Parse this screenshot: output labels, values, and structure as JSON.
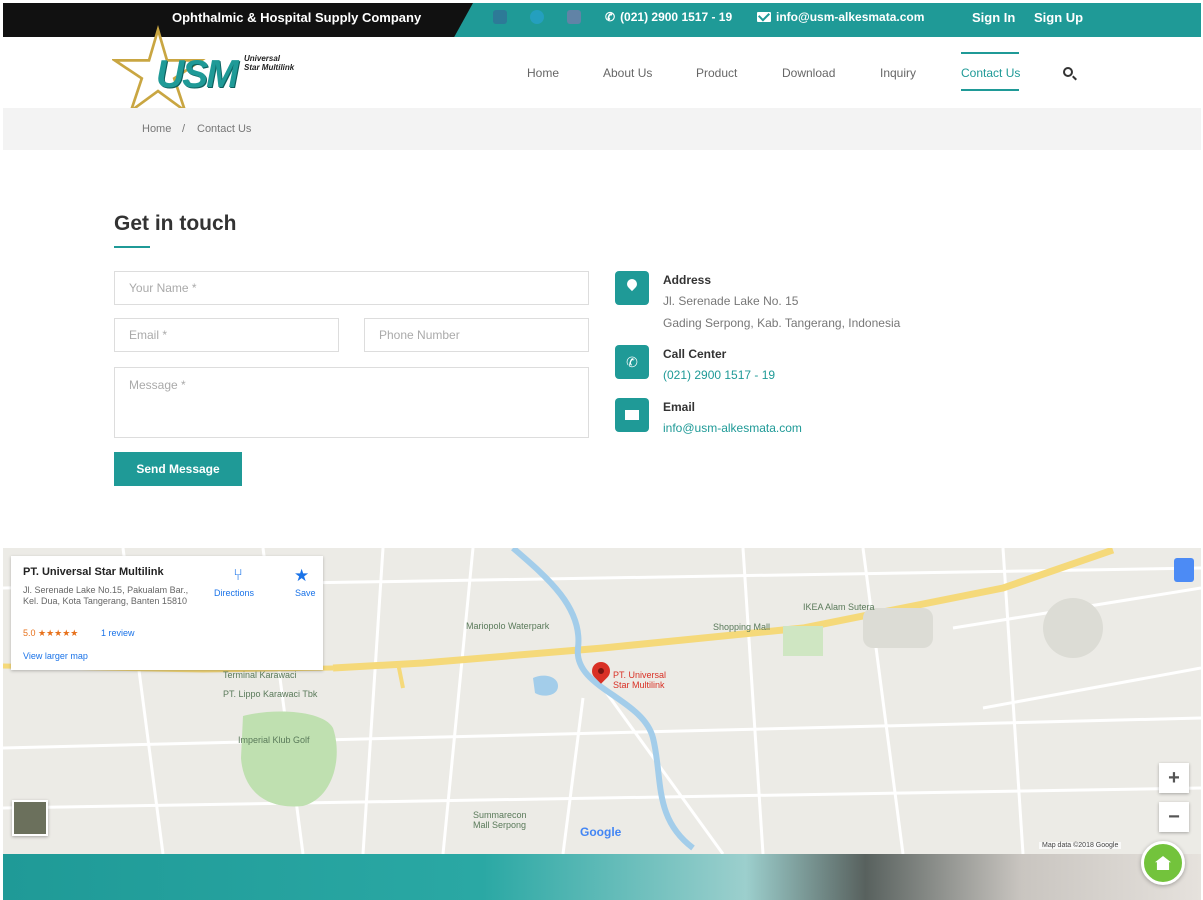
{
  "topbar": {
    "tagline": "Ophthalmic & Hospital Supply Company",
    "phone": "(021) 2900 1517 - 19",
    "email": "info@usm-alkesmata.com",
    "signin": "Sign In",
    "signup": "Sign Up",
    "social_icons": [
      "facebook-icon",
      "twitter-icon",
      "instagram-icon"
    ]
  },
  "logo": {
    "mark": "USM",
    "subtitle": "Universal Star Multilink"
  },
  "nav": {
    "items": [
      "Home",
      "About Us",
      "Product",
      "Download",
      "Inquiry",
      "Contact Us"
    ],
    "active": "Contact Us"
  },
  "breadcrumb": {
    "home": "Home",
    "separator": "/",
    "current": "Contact Us"
  },
  "contact": {
    "title": "Get in touch",
    "form": {
      "name_placeholder": "Your Name *",
      "email_placeholder": "Email *",
      "phone_placeholder": "Phone Number",
      "message_placeholder": "Message *",
      "send_label": "Send Message"
    },
    "address": {
      "heading": "Address",
      "line1": "Jl. Serenade Lake No. 15",
      "line2": "Gading Serpong, Kab. Tangerang, Indonesia"
    },
    "call": {
      "heading": "Call Center",
      "value": "(021) 2900 1517 - 19"
    },
    "email": {
      "heading": "Email",
      "value": "info@usm-alkesmata.com"
    }
  },
  "map": {
    "card": {
      "title": "PT. Universal Star Multilink",
      "address": "Jl. Serenade Lake No.15, Pakualam Bar., Kel. Dua, Kota Tangerang, Banten 15810",
      "rating": "5.0 ★★★★★",
      "reviews": "1 review",
      "view_larger": "View larger map",
      "directions": "Directions",
      "save": "Save"
    },
    "labels": {
      "waterpark": "Mariopolo Waterpark",
      "ikea": "IKEA Alam Sutera",
      "shopping": "Shopping Mall",
      "terminal": "Terminal Karawaci",
      "lippo": "PT. Lippo Karawaci Tbk",
      "golf": "Imperial Klub Golf",
      "summarecon": "Summarecon Mall Serpong",
      "marker": "PT. Universal Star Multilink"
    },
    "google": "Google",
    "attribution": "Map data ©2018 Google",
    "zoom_in": "+",
    "zoom_out": "−"
  },
  "colors": {
    "accent": "#1f9a97",
    "dark": "#111111"
  }
}
